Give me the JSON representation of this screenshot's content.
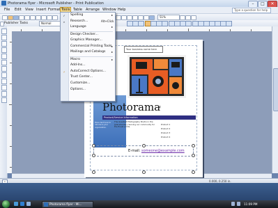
{
  "window": {
    "title": "Photorama flyer - Microsoft Publisher - Print Publication",
    "controls": {
      "minimize": "–",
      "maximize": "□",
      "close": "✕"
    }
  },
  "menubar": {
    "items": [
      "File",
      "Edit",
      "View",
      "Insert",
      "Format",
      "Tools",
      "Table",
      "Arrange",
      "Window",
      "Help"
    ],
    "active": "Tools",
    "help_placeholder": "Type a question for help"
  },
  "toolbar": {
    "zoom": "51%",
    "publisher_tasks": "Publisher Tasks",
    "style": "Normal"
  },
  "tools_menu": {
    "items": [
      {
        "label": "Spelling",
        "shortcut": "",
        "submenu": true,
        "icon": "spelling-icon"
      },
      {
        "label": "Research...",
        "shortcut": "Alt+Click",
        "submenu": false,
        "icon": "research-icon"
      },
      {
        "label": "Language",
        "shortcut": "",
        "submenu": true,
        "icon": ""
      },
      {
        "label": "Design Checker...",
        "shortcut": "",
        "submenu": false,
        "icon": ""
      },
      {
        "label": "Graphics Manager...",
        "shortcut": "",
        "submenu": false,
        "icon": ""
      },
      {
        "label": "Commercial Printing Tools",
        "shortcut": "",
        "submenu": true,
        "icon": ""
      },
      {
        "label": "Mailings and Catalogs",
        "shortcut": "",
        "submenu": true,
        "icon": ""
      },
      {
        "label": "Macro",
        "shortcut": "",
        "submenu": true,
        "icon": ""
      },
      {
        "label": "Add-Ins...",
        "shortcut": "",
        "submenu": false,
        "icon": ""
      },
      {
        "label": "AutoCorrect Options...",
        "shortcut": "",
        "submenu": false,
        "icon": "autocorrect-icon"
      },
      {
        "label": "Trust Center...",
        "shortcut": "",
        "submenu": false,
        "icon": ""
      },
      {
        "label": "Customize...",
        "shortcut": "",
        "submenu": false,
        "icon": ""
      },
      {
        "label": "Options...",
        "shortcut": "",
        "submenu": false,
        "icon": ""
      }
    ]
  },
  "flyer": {
    "logo_text": "Your business name here",
    "title": "Photorama",
    "title_ornament": "¤",
    "tagline": "Product/Service Information",
    "body_text": "The Greatest Photography Studio in the [placeholder]. Serving our community for the finest prints.",
    "side_text": "Place text here to introduce your organization.",
    "bullets": [
      "Product 1",
      "Product 2",
      "Product 3",
      "Product 4"
    ],
    "email_label": "E-mail:",
    "email_value": "someone@example.com"
  },
  "statusbar": {
    "pages": [
      "1"
    ],
    "coords": "0.000, 0.250 in."
  },
  "taskbar": {
    "task_label": "Photorama flyer - Mi...",
    "time": "11:09 PM"
  },
  "colors": {
    "accent": "#2f6db5",
    "menu_highlight": "#f5d88a",
    "tagline_bg": "#2f2f82",
    "panel_blue": "#4a7cc1"
  }
}
